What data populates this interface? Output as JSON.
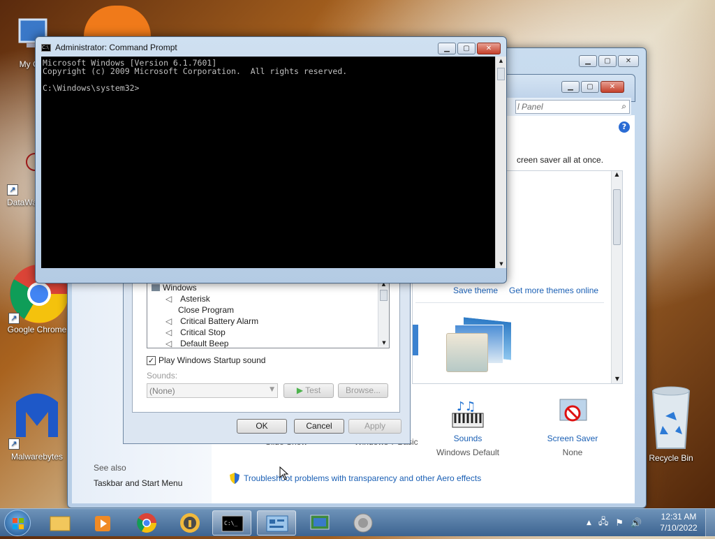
{
  "desktop": {
    "icons": [
      {
        "name": "my-computer",
        "label": "My Co"
      },
      {
        "name": "datawa",
        "label": "DataWa"
      },
      {
        "name": "google-chrome",
        "label": "Google Chrome"
      },
      {
        "name": "malwarebytes",
        "label": "Malwarebytes"
      },
      {
        "name": "recycle-bin",
        "label": "Recycle Bin"
      }
    ]
  },
  "cmd": {
    "title": "Administrator: Command Prompt",
    "lines": [
      "Microsoft Windows [Version 6.1.7601]",
      "Copyright (c) 2009 Microsoft Corporation.  All rights reserved.",
      "",
      "C:\\Windows\\system32>"
    ]
  },
  "control_panel": {
    "search_placeholder": "l Panel",
    "description_fragment": "creen saver all at once.",
    "links": {
      "save_theme": "Save theme",
      "more_themes": "Get more themes online"
    },
    "settings": [
      {
        "label": "Slide Show",
        "value": ""
      },
      {
        "label": "Windows 7 Basic",
        "value": ""
      },
      {
        "label": "Sounds",
        "value": "Windows Default"
      },
      {
        "label": "Screen Saver",
        "value": "None"
      }
    ],
    "see_also": {
      "heading": "See also",
      "item": "Taskbar and Start Menu"
    },
    "troubleshoot_link": "Troubleshoot problems with transparency and other Aero effects"
  },
  "sound_dialog": {
    "tree_root": "Windows",
    "events": [
      "Asterisk",
      "Close Program",
      "Critical Battery Alarm",
      "Critical Stop",
      "Default Beep"
    ],
    "startup_checkbox": "Play Windows Startup sound",
    "sounds_label": "Sounds:",
    "sounds_value": "(None)",
    "test_button": "Test",
    "browse_button": "Browse...",
    "ok_button": "OK",
    "cancel_button": "Cancel",
    "apply_button": "Apply"
  },
  "taskbar": {
    "time": "12:31 AM",
    "date": "7/10/2022"
  }
}
